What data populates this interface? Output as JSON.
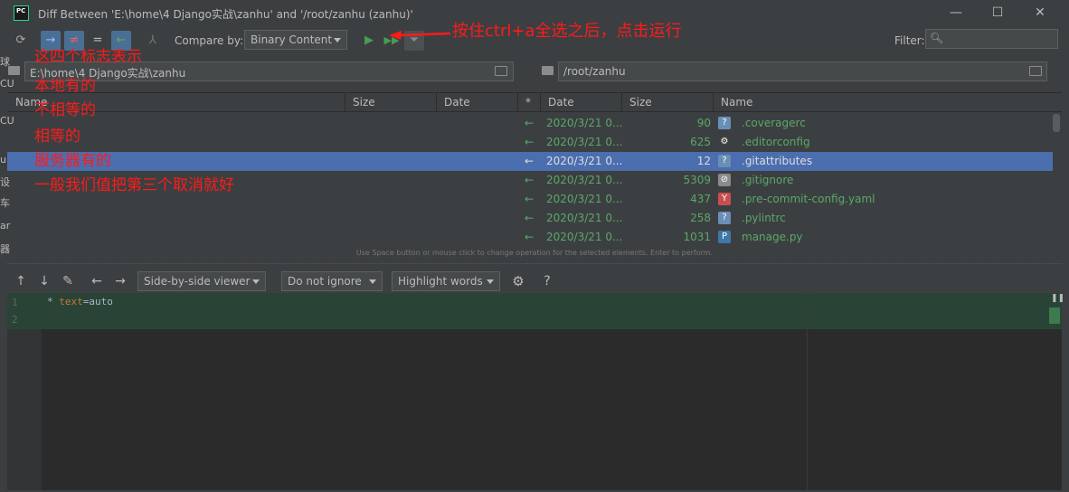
{
  "window": {
    "title": "Diff Between 'E:\\home\\4 Django实战\\zanhu' and '/root/zanhu (zanhu)'",
    "app_icon_label": "PC",
    "controls": {
      "minimize": "—",
      "maximize": "☐",
      "close": "✕"
    }
  },
  "toolbar": {
    "compare_by_label": "Compare by:",
    "compare_by_value": "Binary Content",
    "filter_label": "Filter:",
    "filter_placeholder": ""
  },
  "paths": {
    "left": "E:\\home\\4 Django实战\\zanhu",
    "right": "/root/zanhu"
  },
  "table": {
    "headers": [
      "Name",
      "Size",
      "Date",
      "*",
      "Date",
      "Size",
      "Name"
    ],
    "rows": [
      {
        "arrow": "←",
        "date": "2020/3/21 0...",
        "size": "90",
        "name": ".coveragerc",
        "icon": "unknown-file-icon",
        "selected": false
      },
      {
        "arrow": "←",
        "date": "2020/3/21 0...",
        "size": "625",
        "name": ".editorconfig",
        "icon": "gear-file-icon",
        "selected": false
      },
      {
        "arrow": "←",
        "date": "2020/3/21 0...",
        "size": "12",
        "name": ".gitattributes",
        "icon": "unknown-file-icon",
        "selected": true
      },
      {
        "arrow": "←",
        "date": "2020/3/21 0...",
        "size": "5309",
        "name": ".gitignore",
        "icon": "ignore-file-icon",
        "selected": false
      },
      {
        "arrow": "←",
        "date": "2020/3/21 0...",
        "size": "437",
        "name": ".pre-commit-config.yaml",
        "icon": "yaml-file-icon",
        "selected": false
      },
      {
        "arrow": "←",
        "date": "2020/3/21 0...",
        "size": "258",
        "name": ".pylintrc",
        "icon": "unknown-file-icon",
        "selected": false
      },
      {
        "arrow": "←",
        "date": "2020/3/21 0...",
        "size": "1031",
        "name": "manage.py",
        "icon": "python-file-icon",
        "selected": false
      }
    ],
    "hint": "Use Space button or mouse click to change operation for the selected elements. Enter to perform."
  },
  "diff_toolbar": {
    "viewer": "Side-by-side viewer",
    "ignore": "Do not ignore",
    "highlight": "Highlight words",
    "help": "?"
  },
  "editor": {
    "line_numbers": [
      "1",
      "2"
    ],
    "code": {
      "star": "* ",
      "key": "text",
      "eq": "=",
      "value": "auto"
    }
  },
  "left_edge_chars": [
    "球",
    "CU",
    "CU",
    "u",
    "设",
    "车",
    "ar",
    "器"
  ],
  "annotations": {
    "top": "按住ctrl+a全选之后，点击运行",
    "lines": [
      "这四个标志表示",
      "本地有的",
      "不相等的",
      "相等的",
      "服务器有的",
      "一般我们值把第三个取消就好"
    ]
  },
  "colors": {
    "background": "#3c3f41",
    "selection": "#4b6eaf",
    "added_green": "#59a869",
    "annotation_red": "#ff1a1a",
    "diff_band": "#294436"
  }
}
